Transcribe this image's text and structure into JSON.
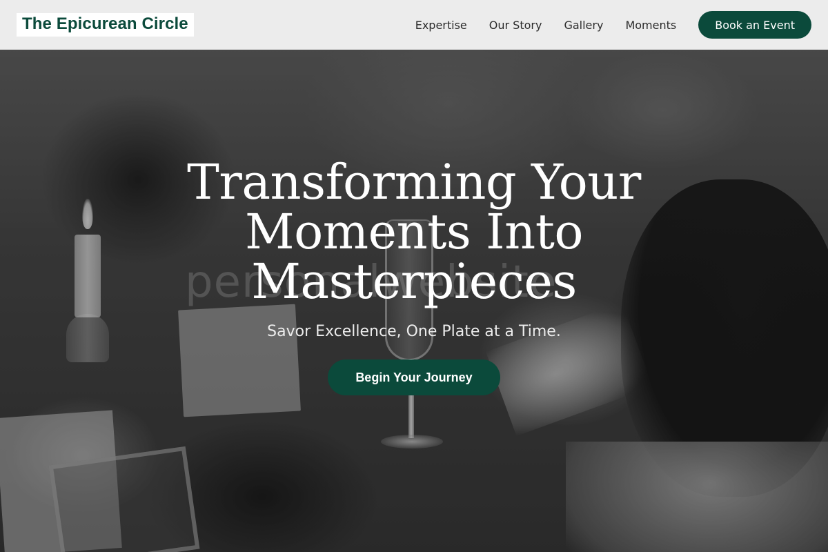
{
  "header": {
    "brand": "The Epicurean Circle",
    "nav": [
      {
        "label": "Expertise"
      },
      {
        "label": "Our Story"
      },
      {
        "label": "Gallery"
      },
      {
        "label": "Moments"
      }
    ],
    "cta_label": "Book an Event"
  },
  "hero": {
    "title": "Transforming Your Moments Into Masterpieces",
    "subtitle": "Savor Excellence, One Plate at a Time.",
    "button_label": "Begin Your Journey",
    "watermark": "personalwebsite"
  },
  "colors": {
    "brand_green": "#0b4a3b",
    "header_bg": "#f2f2f2",
    "hero_text": "#ffffff"
  },
  "icons": []
}
